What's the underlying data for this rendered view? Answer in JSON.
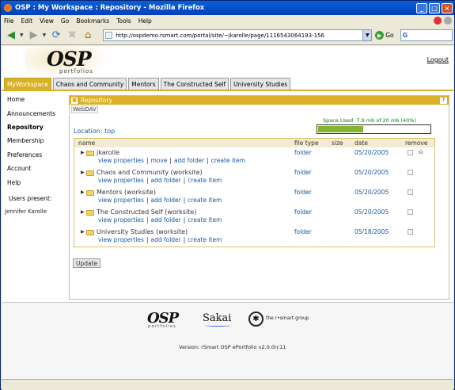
{
  "window": {
    "title": "OSP : My Workspace : Repository - Mozilla Firefox"
  },
  "menu": [
    "File",
    "Edit",
    "View",
    "Go",
    "Bookmarks",
    "Tools",
    "Help"
  ],
  "navbar": {
    "url": "http://ospdemo.rsmart.com/portal/site/~jkarolle/page/1116543064193-156",
    "go_label": "Go",
    "search_glyph": "G"
  },
  "header": {
    "logo_main": "OSP",
    "logo_sub": "portfolios",
    "logout": "Logout"
  },
  "tabs": [
    "MyWorkspace",
    "Chaos and Community",
    "Mentors",
    "The Constructed Self",
    "University Studies"
  ],
  "active_tab": "MyWorkspace",
  "left_nav": {
    "items": [
      "Home",
      "Announcements",
      "Repository",
      "Membership",
      "Preferences",
      "Account",
      "Help"
    ],
    "selected": "Repository",
    "users_present_label": "Users present:",
    "user": "Jennifer Karolle"
  },
  "tool": {
    "title": "Repository",
    "help": "?",
    "webdav": "WebDAV",
    "space_used": "Space Used: 7.9 mb of 20 mb  (40%)",
    "space_fraction": 0.4,
    "location_label": "Location:",
    "location_value": "top",
    "columns": [
      "name",
      "file type",
      "size",
      "date",
      "remove"
    ],
    "rows": [
      {
        "name": "jkarolle",
        "actions": [
          "view properties",
          "move",
          "add folder",
          "create item"
        ],
        "type": "folder",
        "date": "05/20/2005"
      },
      {
        "name": "Chaos and Community (worksite)",
        "actions": [
          "view properties",
          "add folder",
          "create item"
        ],
        "type": "folder",
        "date": "05/20/2005"
      },
      {
        "name": "Mentors (worksite)",
        "actions": [
          "view properties",
          "add folder",
          "create item"
        ],
        "type": "folder",
        "date": "05/20/2005"
      },
      {
        "name": "The Constructed Self (worksite)",
        "actions": [
          "view properties",
          "add folder",
          "create item"
        ],
        "type": "folder",
        "date": "05/20/2005"
      },
      {
        "name": "University Studies (worksite)",
        "actions": [
          "view properties",
          "add folder",
          "create item"
        ],
        "type": "folder",
        "date": "05/18/2005"
      }
    ],
    "update_label": "Update"
  },
  "footer": {
    "osp": "OSP",
    "osp_sub": "portfolios",
    "sakai": "Sakai",
    "rsmart": "the r•smart group",
    "version": "Version: rSmart OSP ePortfolio v2.0.0rc11"
  }
}
